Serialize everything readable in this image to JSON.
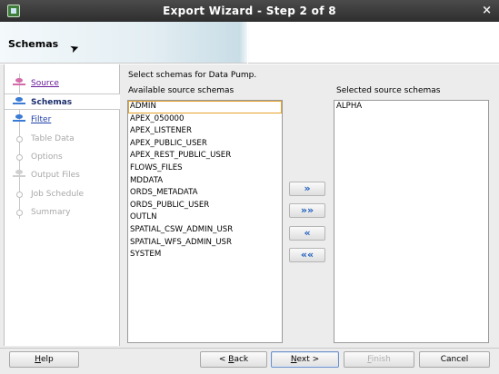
{
  "window": {
    "title": "Export Wizard - Step 2 of 8",
    "close_glyph": "×"
  },
  "header": {
    "page_title": "Schemas"
  },
  "nav": {
    "items": [
      {
        "label": "Source",
        "state": "visited"
      },
      {
        "label": "Schemas",
        "state": "active"
      },
      {
        "label": "Filter",
        "state": "link"
      },
      {
        "label": "Table Data",
        "state": "disabled"
      },
      {
        "label": "Options",
        "state": "disabled"
      },
      {
        "label": "Output Files",
        "state": "disabled"
      },
      {
        "label": "Job Schedule",
        "state": "disabled"
      },
      {
        "label": "Summary",
        "state": "disabled"
      }
    ]
  },
  "main": {
    "instruction": "Select schemas for Data Pump.",
    "available_label": "Available source schemas",
    "selected_label": "Selected source schemas",
    "available": [
      "ADMIN",
      "APEX_050000",
      "APEX_LISTENER",
      "APEX_PUBLIC_USER",
      "APEX_REST_PUBLIC_USER",
      "FLOWS_FILES",
      "MDDATA",
      "ORDS_METADATA",
      "ORDS_PUBLIC_USER",
      "OUTLN",
      "SPATIAL_CSW_ADMIN_USR",
      "SPATIAL_WFS_ADMIN_USR",
      "SYSTEM"
    ],
    "focused_index": 0,
    "selected": [
      "ALPHA"
    ],
    "shuttle": {
      "move": "»",
      "move_all": "»»",
      "remove": "«",
      "remove_all": "««"
    }
  },
  "footer": {
    "help": {
      "key": "H",
      "rest": "elp"
    },
    "back": {
      "pre": "< ",
      "key": "B",
      "rest": "ack"
    },
    "next": {
      "key": "N",
      "rest": "ext >"
    },
    "finish": {
      "key": "F",
      "rest": "inish"
    },
    "cancel": "Cancel"
  }
}
